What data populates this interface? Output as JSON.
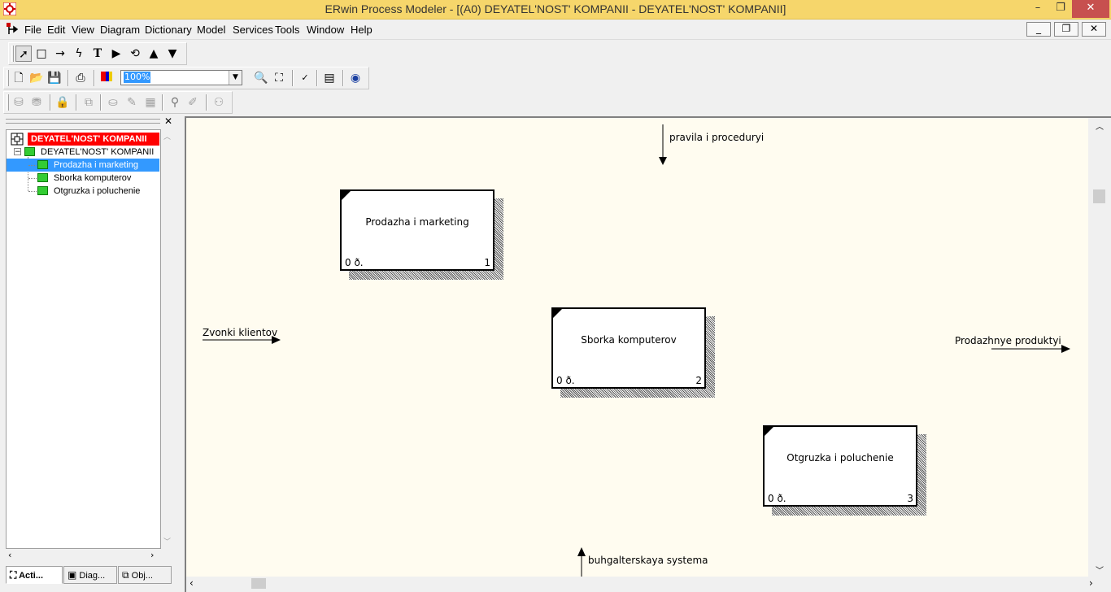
{
  "window": {
    "title": "ERwin Process Modeler - [(A0) DEYATEL'NOST' KOMPANII - DEYATEL'NOST' KOMPANII]",
    "minimize": "–",
    "restore": "❐",
    "close": "✕"
  },
  "menu": {
    "items": [
      "File",
      "Edit",
      "View",
      "Diagram",
      "Dictionary",
      "Model",
      "Services",
      "Tools",
      "Window",
      "Help"
    ],
    "mdi_minimize": "_",
    "mdi_restore": "❐",
    "mdi_close": "✕"
  },
  "toolbar": {
    "zoom_value": "100%"
  },
  "tree": {
    "root": "DEYATEL'NOST' KOMPANII",
    "parent": "DEYATEL'NOST' KOMPANII",
    "children": [
      "Prodazha i marketing",
      "Sborka komputerov",
      "Otgruzka i poluchenie"
    ],
    "selected_index": 0
  },
  "tabs": [
    "Acti...",
    "Diag...",
    "Obj..."
  ],
  "diagram": {
    "boxes": [
      {
        "name": "Prodazha i marketing",
        "cost": "0 ð.",
        "number": "1"
      },
      {
        "name": "Sborka komputerov",
        "cost": "0 ð.",
        "number": "2"
      },
      {
        "name": "Otgruzka i poluchenie",
        "cost": "0 ð.",
        "number": "3"
      }
    ],
    "arrows": {
      "control": "pravila i proceduryi",
      "input": "Zvonki klientov",
      "output": "Prodazhnye produktyi",
      "mechanism": "buhgalterskaya systema"
    }
  },
  "colors": {
    "titlebar": "#f6d66b",
    "canvas": "#fffcf0",
    "selected": "#3399ff",
    "tree_root": "#ff0000",
    "activity_green": "#33cc33"
  }
}
